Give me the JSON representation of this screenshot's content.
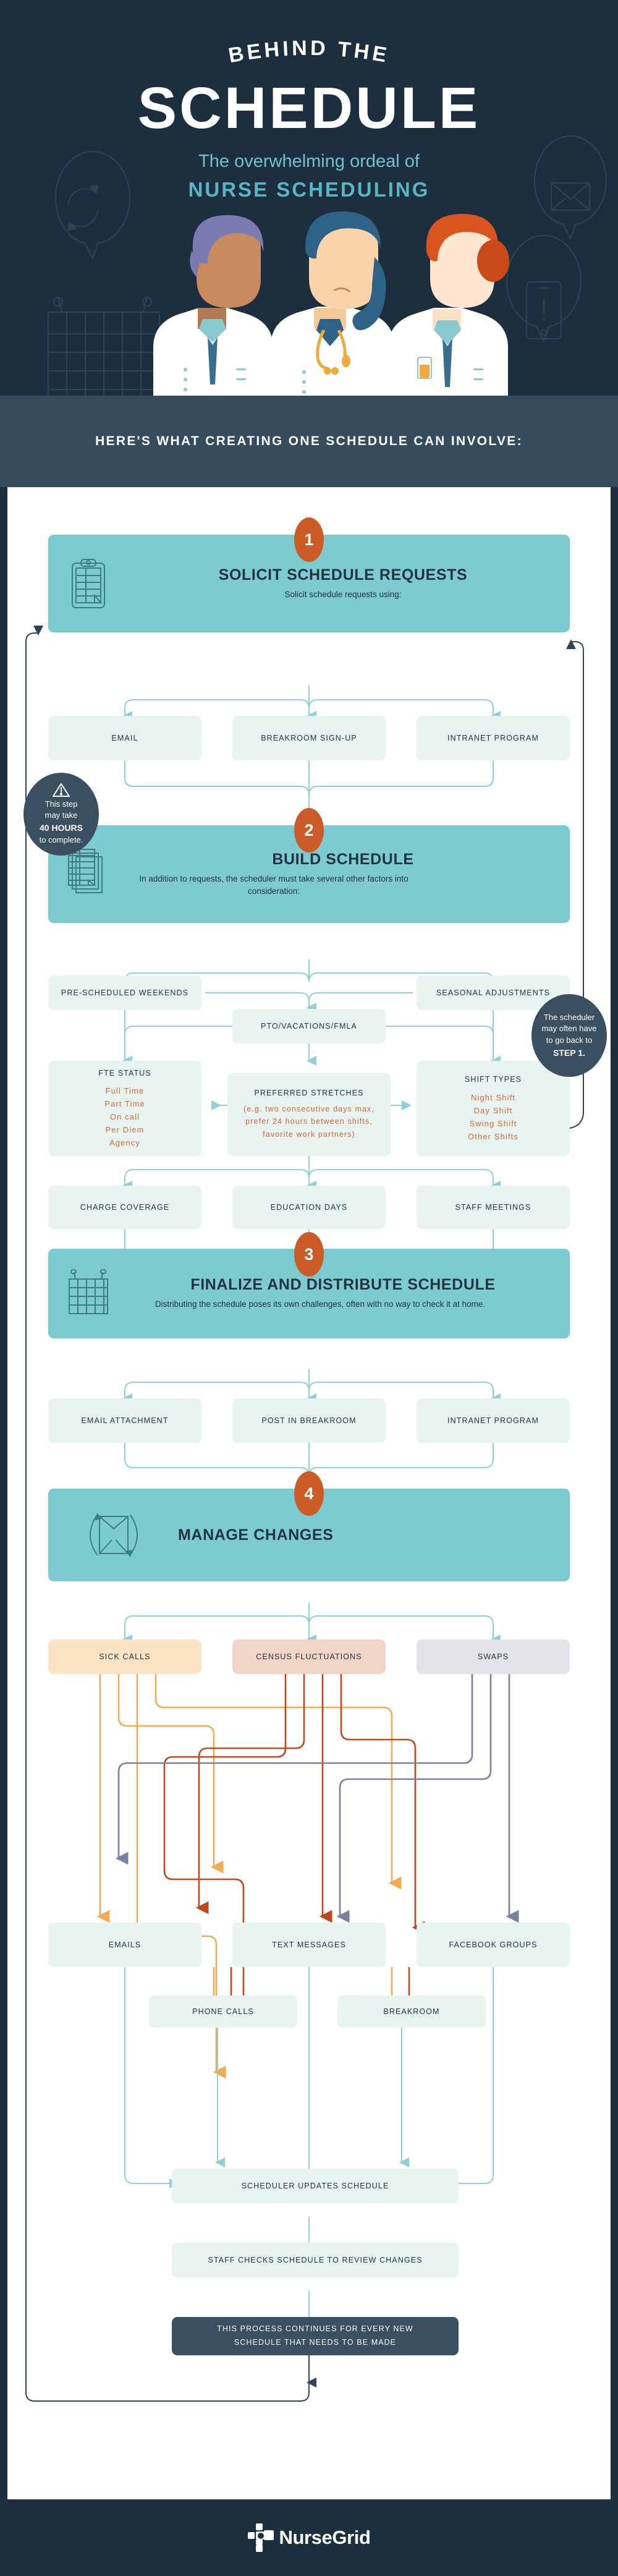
{
  "colors": {
    "navy": "#1d2e3f",
    "banner_navy": "#344c5c",
    "teal": "#7ccbd1",
    "teal_accent": "#57b6c4",
    "orange": "#cb5c28",
    "orange_text": "#d9662f",
    "mint": "#e6f3f1",
    "peach": "#fbe3c3",
    "salmon": "#f3d5c7",
    "lavender": "#e4e3e9",
    "dark_slate": "#3a4f60"
  },
  "hero": {
    "arc_title": "BEHIND THE",
    "big_title": "SCHEDULE",
    "subtitle_line1": "The overwhelming ordeal of",
    "subtitle_line2": "NURSE SCHEDULING"
  },
  "banner": {
    "text": "HERE'S WHAT CREATING ONE SCHEDULE CAN INVOLVE:"
  },
  "steps": [
    {
      "number": "1",
      "title": "SOLICIT SCHEDULE REQUESTS",
      "desc": "Solicit schedule requests using:",
      "icon": "clipboard-icon",
      "children": [
        "EMAIL",
        "BREAKROOM SIGN-UP",
        "INTRANET PROGRAM"
      ]
    },
    {
      "number": "2",
      "title": "BUILD SCHEDULE",
      "desc": "In addition to requests, the scheduler must take several other factors into consideration:",
      "icon": "stacked-schedules-icon",
      "children": []
    },
    {
      "number": "3",
      "title": "FINALIZE AND DISTRIBUTE SCHEDULE",
      "desc": "Distributing the schedule poses its own challenges, often with no way to check it at home.",
      "icon": "calendar-icon",
      "children": [
        "EMAIL ATTACHMENT",
        "POST IN BREAKROOM",
        "INTRANET PROGRAM"
      ]
    },
    {
      "number": "4",
      "title": "MANAGE CHANGES",
      "desc": "",
      "icon": "envelope-cycle-icon",
      "children": []
    }
  ],
  "bubbles": {
    "forty_hours": {
      "icon": "warning-triangle-icon",
      "line1": "This step",
      "line2": "may take",
      "highlight": "40 HOURS",
      "line3": "to complete."
    },
    "back_to_step_one": {
      "line1": "The scheduler",
      "line2": "may often have",
      "line3": "to go back to",
      "highlight": "STEP 1."
    }
  },
  "build_factors": {
    "row1": [
      "PRE-SCHEDULED WEEKENDS",
      "SEASONAL ADJUSTMENTS"
    ],
    "row2": [
      "PTO/VACATIONS/FMLA"
    ],
    "fte": {
      "heading": "FTE STATUS",
      "items": [
        "Full Time",
        "Part Time",
        "On call",
        "Per Diem",
        "Agency"
      ]
    },
    "preferred_stretches": {
      "heading": "PREFERRED STRETCHES",
      "body": "(e.g. two consecutive days max, prefer 24 hours between shifts, favorite work partners)"
    },
    "shift_types": {
      "heading": "SHIFT TYPES",
      "items": [
        "Night Shift",
        "Day Shift",
        "Swing Shift",
        "Other Shifts"
      ]
    },
    "row4": [
      "CHARGE COVERAGE",
      "EDUCATION DAYS",
      "STAFF MEETINGS"
    ]
  },
  "changes": {
    "sources": [
      "SICK CALLS",
      "CENSUS FLUCTUATIONS",
      "SWAPS"
    ],
    "channels_row1": [
      "EMAILS",
      "TEXT MESSAGES",
      "FACEBOOK GROUPS"
    ],
    "channels_row2": [
      "PHONE CALLS",
      "BREAKROOM"
    ],
    "update": "SCHEDULER UPDATES SCHEDULE",
    "review": "STAFF CHECKS SCHEDULE TO REVIEW CHANGES",
    "loop_line1": "THIS PROCESS CONTINUES FOR EVERY NEW",
    "loop_line2": "SCHEDULE THAT NEEDS TO BE MADE"
  },
  "footer": {
    "brand": "NurseGrid",
    "logo_icon": "nursegrid-cross-logo"
  }
}
